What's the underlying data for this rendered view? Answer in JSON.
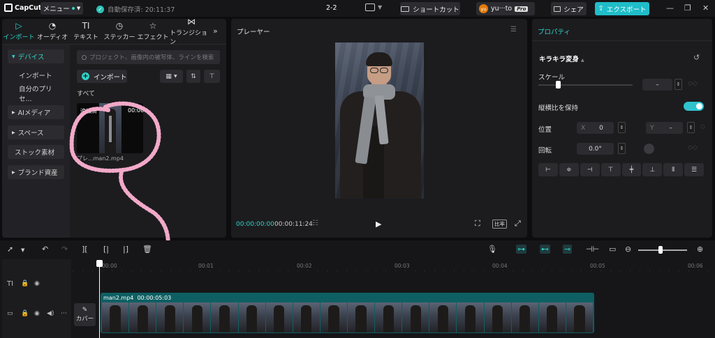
{
  "titlebar": {
    "app_name": "CapCut",
    "menu_label": "メニュー",
    "save_status": "自動保存済: 20:11:37",
    "project_name": "2-2",
    "shortcut_label": "ショートカット",
    "user_name": "yu···to",
    "user_initials": "yu",
    "pro_badge": "Pro",
    "share_label": "シェア",
    "export_label": "エクスポート",
    "accent_color": "#1fbdc9"
  },
  "top_tabs": [
    {
      "label": "インポート",
      "icon": "import-icon"
    },
    {
      "label": "オーディオ",
      "icon": "audio-icon"
    },
    {
      "label": "テキスト",
      "icon": "text-icon"
    },
    {
      "label": "ステッカー",
      "icon": "sticker-icon"
    },
    {
      "label": "エフェクト",
      "icon": "effect-icon"
    },
    {
      "label": "トランジション",
      "icon": "transition-icon"
    }
  ],
  "left_nav": [
    {
      "label": "デバイス"
    },
    {
      "label": "インポート"
    },
    {
      "label": "自分のプリセ..."
    },
    {
      "label": "AIメディア"
    },
    {
      "label": "スペース"
    },
    {
      "label": "ストック素材"
    },
    {
      "label": "ブランド資産"
    }
  ],
  "media": {
    "search_placeholder": "プロジェクト、画像内の被写体、ラインを検索",
    "import_label": "インポート",
    "section_all": "すべて",
    "clip_added": "追加済",
    "clip_duration": "00:06",
    "clip_name": "プレ...man2.mp4"
  },
  "player": {
    "title": "プレーヤー",
    "current_time": "00:00:00:00",
    "total_time": "00:00:11:24",
    "ratio_label": "比率"
  },
  "properties": {
    "tab_label": "プロパティ",
    "section": "キラキラ変身",
    "scale_label": "スケール",
    "scale_value": "–",
    "aspect_label": "縦横比を保持",
    "position_label": "位置",
    "x_label": "X",
    "x_value": "0",
    "y_label": "Y",
    "y_value": "–",
    "rotation_label": "回転",
    "rotation_value": "0.0°"
  },
  "timeline": {
    "ruler": [
      "00:00",
      "00:01",
      "00:02",
      "00:03",
      "00:04",
      "00:05",
      "00:06"
    ],
    "clip_name": "man2.mp4",
    "clip_duration": "00:00:05:03",
    "cover_label": "カバー"
  }
}
